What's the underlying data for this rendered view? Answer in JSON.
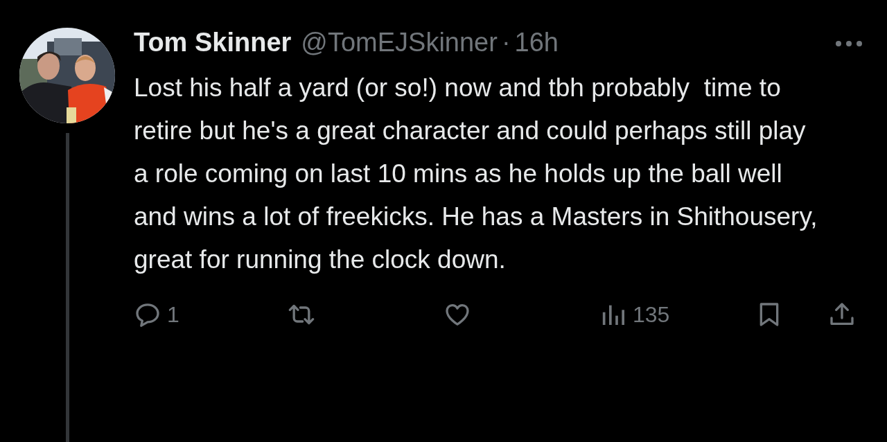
{
  "tweet": {
    "author": {
      "name": "Tom Skinner",
      "handle": "@TomEJSkinner",
      "separator": "·",
      "time": "16h"
    },
    "text": "Lost his half a yard (or so!) now and tbh probably  time to retire but he's a great character and could perhaps still play a role coming on last 10 mins as he holds up the ball well and wins a lot of freekicks. He has a Masters in Shithousery, great for running the clock down.",
    "actions": [
      {
        "kind": "reply",
        "count": "1"
      },
      {
        "kind": "retweet"
      },
      {
        "kind": "like"
      },
      {
        "kind": "views",
        "count": "135"
      },
      {
        "kind": "bookmark"
      },
      {
        "kind": "share"
      }
    ]
  }
}
